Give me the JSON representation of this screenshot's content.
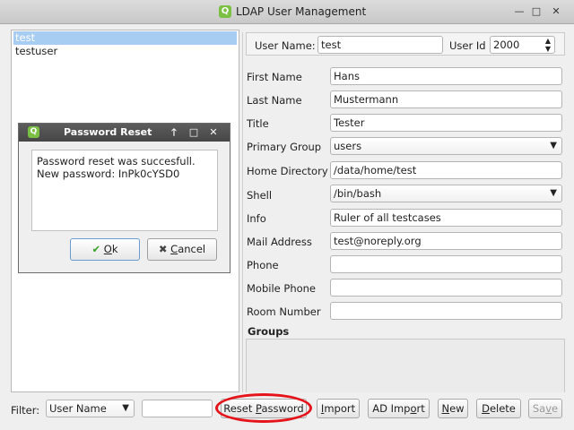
{
  "window": {
    "title": "LDAP User Management",
    "app_icon_glyph": "Q",
    "minimize_glyph": "—",
    "maximize_glyph": "□",
    "close_glyph": "✕"
  },
  "user_list": {
    "items": [
      "test",
      "testuser"
    ],
    "selected_index": 0
  },
  "form": {
    "user_name_label": "User Name:",
    "user_name_value": "test",
    "user_id_label": "User Id",
    "user_id_value": "2000",
    "first_name_label": "First Name",
    "first_name_value": "Hans",
    "last_name_label": "Last Name",
    "last_name_value": "Mustermann",
    "title_label": "Title",
    "title_value": "Tester",
    "primary_group_label": "Primary Group",
    "primary_group_value": "users",
    "home_dir_label": "Home Directory",
    "home_dir_value": "/data/home/test",
    "shell_label": "Shell",
    "shell_value": "/bin/bash",
    "info_label": "Info",
    "info_value": "Ruler of all testcases",
    "mail_label": "Mail Address",
    "mail_value": "test@noreply.org",
    "phone_label": "Phone",
    "phone_value": "",
    "mobile_label": "Mobile Phone",
    "mobile_value": "",
    "room_label": "Room Number",
    "room_value": "",
    "groups_label": "Groups"
  },
  "bottom_bar": {
    "filter_label": "Filter:",
    "filter_combo_value": "User Name",
    "filter_text_value": "",
    "reset_password_pre": "Reset ",
    "reset_password_ul": "P",
    "reset_password_post": "assword",
    "import_ul": "I",
    "import_post": "mport",
    "ad_import_pre": "AD Imp",
    "ad_import_ul": "o",
    "ad_import_post": "rt",
    "new_ul": "N",
    "new_post": "ew",
    "delete_ul": "D",
    "delete_post": "elete",
    "save_pre": "Sa",
    "save_ul": "v",
    "save_post": "e"
  },
  "dialog": {
    "title": "Password Reset",
    "message_line1": "Password reset was succesfull.",
    "message_line2": "New password: InPk0cYSD0",
    "ok_ul": "O",
    "ok_post": "k",
    "cancel_ul": "C",
    "cancel_post": "ancel",
    "up_glyph": "🡑",
    "max_glyph": "□",
    "close_glyph": "✕"
  },
  "colors": {
    "highlight_ellipse": "#e5141b",
    "selection": "#a8cdf2",
    "app_icon": "#7ac143"
  }
}
